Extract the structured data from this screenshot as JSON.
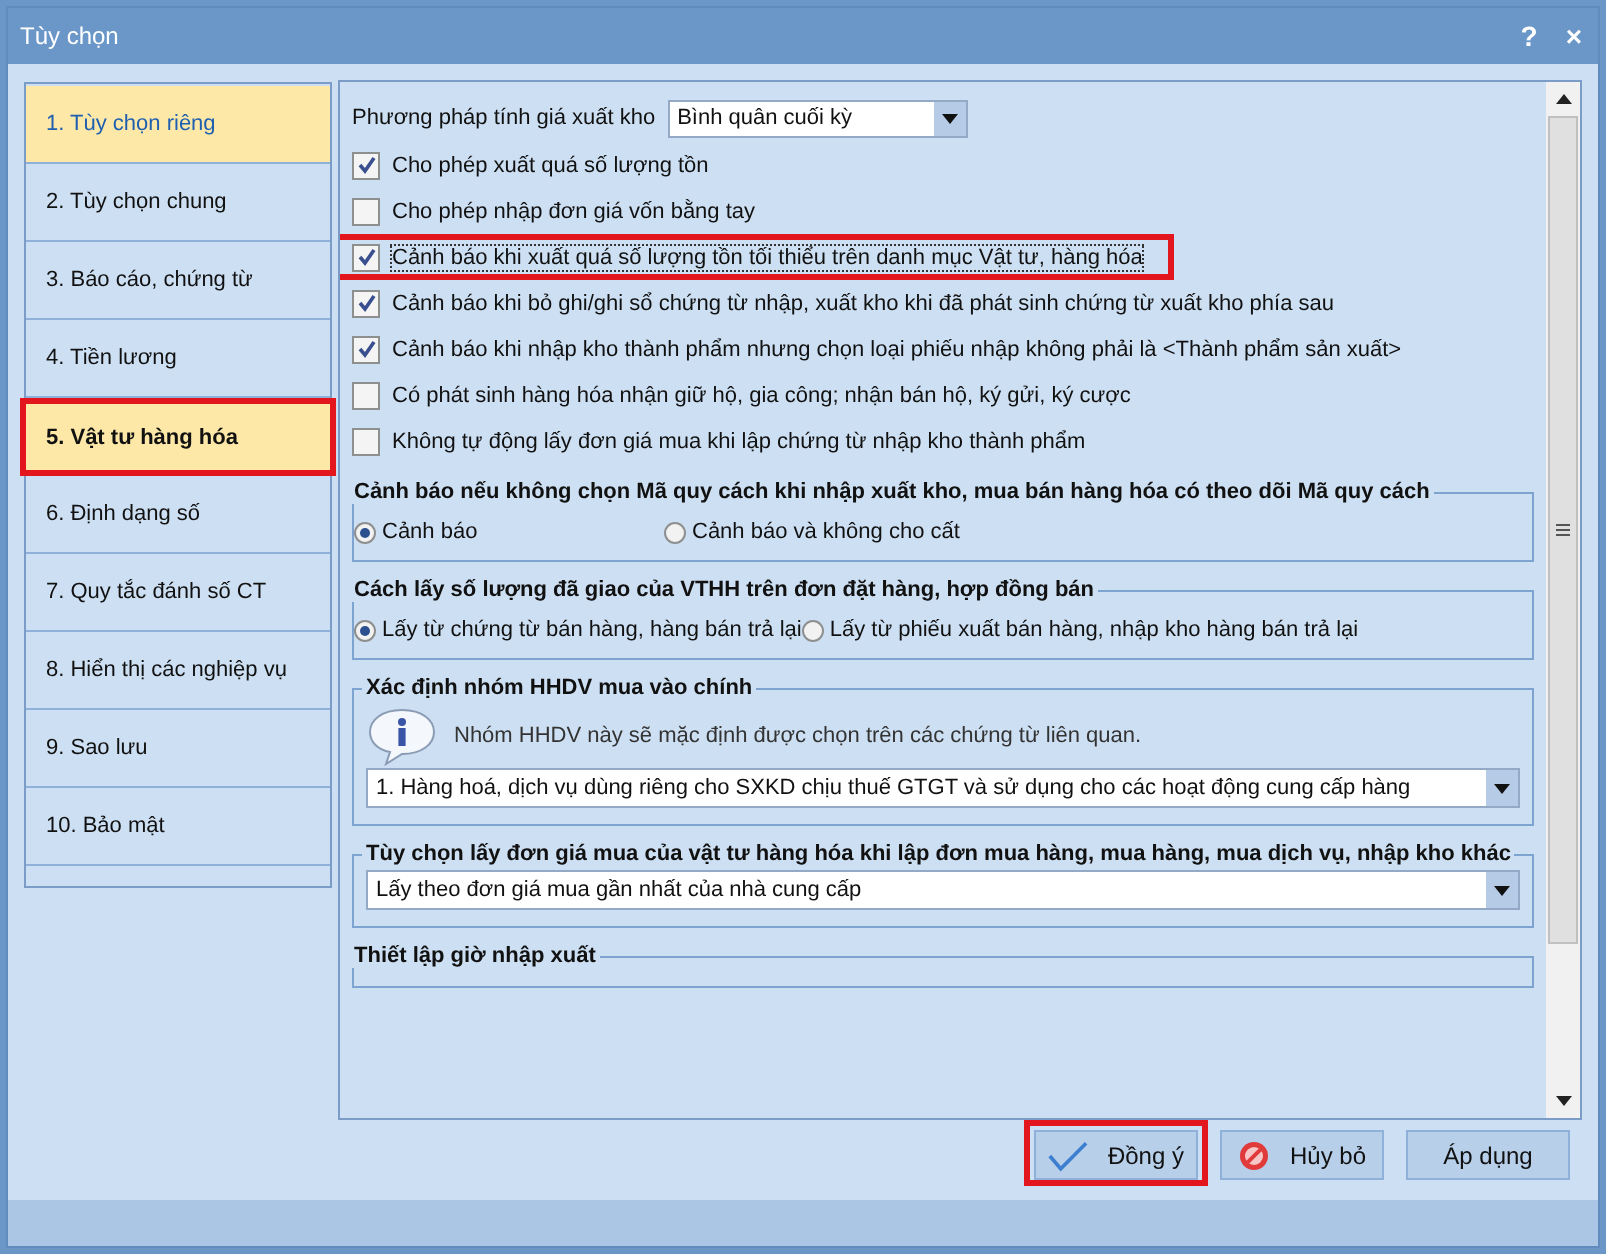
{
  "window": {
    "title": "Tùy chọn",
    "help": "?",
    "close": "×"
  },
  "sidebar": {
    "items": [
      {
        "label": "1. Tùy chọn riêng",
        "selected": false,
        "hovered": true,
        "highlighted": false
      },
      {
        "label": "2. Tùy chọn chung",
        "selected": false,
        "hovered": false,
        "highlighted": false
      },
      {
        "label": "3. Báo cáo, chứng từ",
        "selected": false,
        "hovered": false,
        "highlighted": false
      },
      {
        "label": "4. Tiền lương",
        "selected": false,
        "hovered": false,
        "highlighted": false
      },
      {
        "label": "5. Vật tư hàng hóa",
        "selected": true,
        "hovered": false,
        "highlighted": true
      },
      {
        "label": "6. Định dạng số",
        "selected": false,
        "hovered": false,
        "highlighted": false
      },
      {
        "label": "7. Quy tắc đánh số CT",
        "selected": false,
        "hovered": false,
        "highlighted": false
      },
      {
        "label": "8. Hiển thị các nghiệp vụ",
        "selected": false,
        "hovered": false,
        "highlighted": false
      },
      {
        "label": "9. Sao lưu",
        "selected": false,
        "hovered": false,
        "highlighted": false
      },
      {
        "label": "10. Bảo mật",
        "selected": false,
        "hovered": false,
        "highlighted": false
      }
    ]
  },
  "costing": {
    "label": "Phương pháp tính giá xuất kho",
    "value": "Bình quân cuối kỳ"
  },
  "checkboxes": [
    {
      "label": "Cho phép xuất quá số lượng tồn",
      "checked": true,
      "highlighted": false
    },
    {
      "label": "Cho phép nhập đơn giá vốn bằng tay",
      "checked": false,
      "highlighted": false
    },
    {
      "label": "Cảnh báo khi xuất quá số lượng tồn tối thiểu trên danh mục Vật tư, hàng hóa",
      "checked": true,
      "highlighted": true
    },
    {
      "label": "Cảnh báo khi bỏ ghi/ghi sổ chứng từ nhập, xuất kho khi đã phát sinh chứng từ xuất kho phía sau",
      "checked": true,
      "highlighted": false
    },
    {
      "label": "Cảnh báo khi nhập kho thành phẩm nhưng chọn loại phiếu nhập không phải là <Thành phẩm sản xuất>",
      "checked": true,
      "highlighted": false
    },
    {
      "label": "Có phát sinh hàng hóa nhận giữ hộ, gia công; nhận bán hộ, ký gửi, ký cược",
      "checked": false,
      "highlighted": false
    },
    {
      "label": "Không tự động lấy đơn giá mua khi lập chứng từ nhập kho thành phẩm",
      "checked": false,
      "highlighted": false
    }
  ],
  "groups": [
    {
      "kind": "radios",
      "title": "Cảnh báo nếu không chọn Mã quy cách khi nhập xuất kho, mua bán hàng hóa có theo dõi Mã quy cách",
      "options": [
        {
          "label": "Cảnh báo",
          "selected": true
        },
        {
          "label": "Cảnh báo và không cho cất",
          "selected": false
        }
      ]
    },
    {
      "kind": "radios",
      "title": "Cách lấy số lượng đã giao của VTHH trên đơn đặt hàng, hợp đồng bán",
      "options": [
        {
          "label": "Lấy từ chứng từ bán hàng, hàng bán trả lại",
          "selected": true
        },
        {
          "label": "Lấy từ phiếu xuất bán hàng, nhập kho hàng bán trả lại",
          "selected": false
        }
      ]
    },
    {
      "kind": "info-select",
      "title": "Xác định nhóm HHDV mua vào chính",
      "info": "Nhóm HHDV này sẽ mặc định được chọn trên các chứng từ liên quan.",
      "value": "1. Hàng hoá, dịch vụ dùng riêng cho SXKD chịu thuế GTGT và sử dụng cho các hoạt động cung cấp hàng"
    },
    {
      "kind": "select",
      "title": "Tùy chọn lấy đơn giá mua của vật tư hàng hóa khi lập đơn mua hàng, mua hàng, mua dịch vụ, nhập kho khác",
      "value": "Lấy theo đơn giá mua gần nhất của nhà cung cấp"
    },
    {
      "kind": "empty",
      "title": "Thiết lập giờ nhập xuất"
    }
  ],
  "buttons": [
    {
      "kind": "ok",
      "label": "Đồng ý",
      "highlighted": true
    },
    {
      "kind": "cancel",
      "label": "Hủy bỏ",
      "highlighted": false
    },
    {
      "kind": "apply",
      "label": "Áp dụng",
      "highlighted": false
    }
  ]
}
